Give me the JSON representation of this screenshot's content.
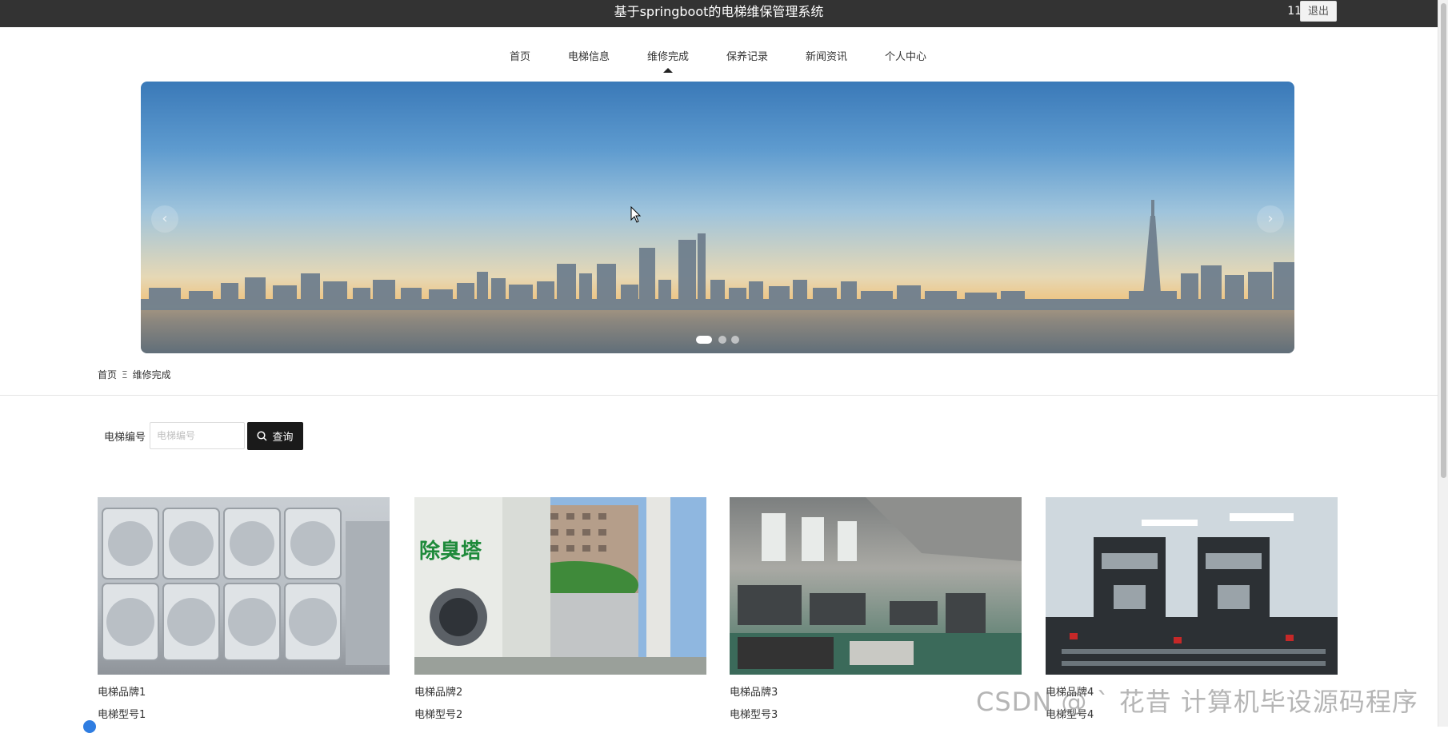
{
  "header": {
    "title": "基于springboot的电梯维保管理系统",
    "user": "111",
    "logout_label": "退出"
  },
  "nav": {
    "items": [
      {
        "label": "首页"
      },
      {
        "label": "电梯信息"
      },
      {
        "label": "维修完成"
      },
      {
        "label": "保养记录"
      },
      {
        "label": "新闻资讯"
      },
      {
        "label": "个人中心"
      }
    ],
    "active": "维修完成"
  },
  "banner": {
    "slides": 3,
    "active_slide": 1,
    "prev_glyph": "‹",
    "next_glyph": "›"
  },
  "breadcrumb": {
    "home": "首页",
    "separator": "Ξ",
    "current": "维修完成"
  },
  "search": {
    "label": "电梯编号",
    "placeholder": "电梯编号",
    "value": "",
    "button_label": "查询"
  },
  "cards": [
    {
      "brand": "电梯品牌1",
      "model": "电梯型号1"
    },
    {
      "brand": "电梯品牌2",
      "model": "电梯型号2",
      "image_text": "除臭塔"
    },
    {
      "brand": "电梯品牌3",
      "model": "电梯型号3"
    },
    {
      "brand": "电梯品牌4",
      "model": "电梯型号4"
    }
  ],
  "watermark": "CSDN @ ` 花昔  计算机毕设源码程序",
  "colors": {
    "topbar": "#333333",
    "search_button": "#1a1a1a",
    "accent": "#2f7de1"
  }
}
